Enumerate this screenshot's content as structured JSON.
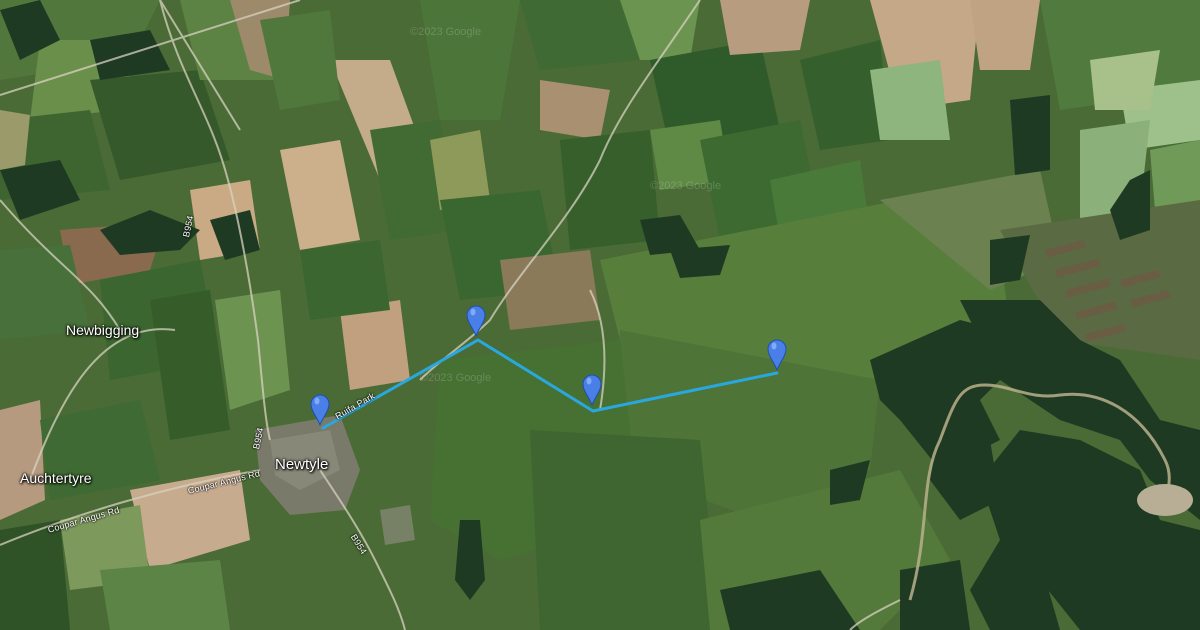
{
  "map": {
    "view": "satellite",
    "places": [
      {
        "id": "newbigging",
        "label": "Newbigging"
      },
      {
        "id": "auchtertyre",
        "label": "Auchtertyre"
      },
      {
        "id": "newtyle",
        "label": "Newtyle"
      }
    ],
    "roads": [
      {
        "id": "b954-north",
        "label": "B954"
      },
      {
        "id": "b954-newtyle",
        "label": "B954"
      },
      {
        "id": "b954-south",
        "label": "B954"
      },
      {
        "id": "coupar-angus-rd-east",
        "label": "Coupar Angus Rd"
      },
      {
        "id": "coupar-angus-rd-west",
        "label": "Coupar Angus Rd"
      },
      {
        "id": "ruifa-park",
        "label": "Ruifa Park"
      }
    ],
    "watermark": "©2023 Google",
    "route": {
      "color": "#29a8e0",
      "markers": [
        {
          "id": "marker-1"
        },
        {
          "id": "marker-2"
        },
        {
          "id": "marker-3"
        },
        {
          "id": "marker-4"
        }
      ]
    },
    "colors": {
      "marker": "#4a7fe8",
      "route_line": "#29a8e0",
      "forest": "#1f3a22",
      "field": "#4f7a3a"
    }
  }
}
